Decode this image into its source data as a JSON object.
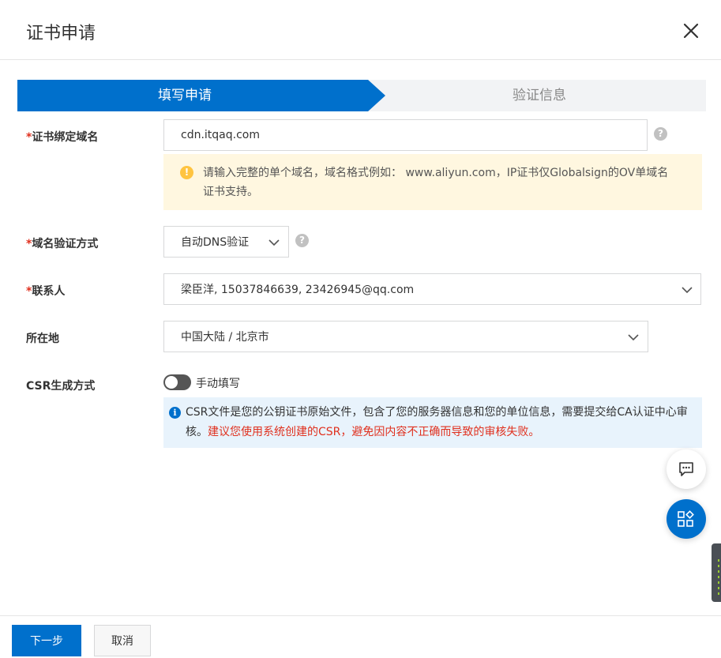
{
  "dialog": {
    "title": "证书申请",
    "close_icon": "close-icon"
  },
  "steps": [
    {
      "label": "填写申请",
      "active": true
    },
    {
      "label": "验证信息",
      "active": false
    }
  ],
  "form": {
    "required_mark": "*",
    "domain": {
      "label": "证书绑定域名",
      "value": "cdn.itqaq.com",
      "help_icon": "?"
    },
    "domain_warning": {
      "icon": "!",
      "text": "请输入完整的单个域名，域名格式例如： www.aliyun.com，IP证书仅Globalsign的OV单域名证书支持。"
    },
    "verify_method": {
      "label": "域名验证方式",
      "value": "自动DNS验证",
      "help_icon": "?"
    },
    "contact": {
      "label": "联系人",
      "value": "梁臣洋, 15037846639, 23426945@qq.com"
    },
    "location": {
      "label": "所在地",
      "value": "中国大陆 / 北京市"
    },
    "csr": {
      "label": "CSR生成方式",
      "toggle_label": "手动填写",
      "toggle_on": false,
      "info_icon": "i",
      "info_text": "CSR文件是您的公钥证书原始文件，包含了您的服务器信息和您的单位信息，需要提交给CA认证中心审核。",
      "info_warning": "建议您使用系统创建的CSR，避免因内容不正确而导致的审核失败。"
    }
  },
  "footer": {
    "next_label": "下一步",
    "cancel_label": "取消"
  },
  "colors": {
    "primary": "#0070cc",
    "required": "#e0301e",
    "warning_bg": "#fff7e0",
    "info_bg": "#e8f3fc"
  }
}
